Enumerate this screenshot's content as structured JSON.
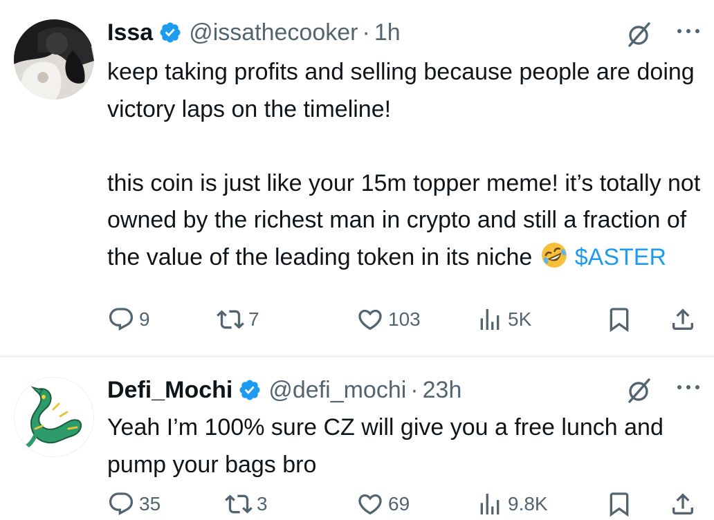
{
  "tweets": [
    {
      "author": {
        "name": "Issa",
        "handle": "@issathecooker",
        "time": "1h",
        "verified": true,
        "avatar_icon": "avatar-photo-icon"
      },
      "text_paragraphs": [
        "keep taking profits and selling because people are doing victory laps on the timeline!",
        "this coin is just like your 15m topper meme! it’s totally not owned by the richest man in crypto and still a fraction of the value of the leading token in its niche"
      ],
      "emoji": "rolling-on-floor-laughing-emoji",
      "cashtag": "$ASTER",
      "actions": {
        "replies": "9",
        "reposts": "7",
        "likes": "103",
        "views": "5K"
      }
    },
    {
      "author": {
        "name": "Defi_Mochi",
        "handle": "@defi_mochi",
        "time": "23h",
        "verified": true,
        "avatar_icon": "green-dragon-avatar-icon"
      },
      "text_paragraphs": [
        "Yeah I’m 100% sure CZ will give you a free lunch and pump your bags bro"
      ],
      "actions": {
        "replies": "35",
        "reposts": "3",
        "likes": "69",
        "views": "9.8K"
      }
    }
  ],
  "separator": "·",
  "colors": {
    "text": "#0f1419",
    "secondary": "#536471",
    "accent": "#1d9bf0",
    "divider": "#eff3f4"
  }
}
